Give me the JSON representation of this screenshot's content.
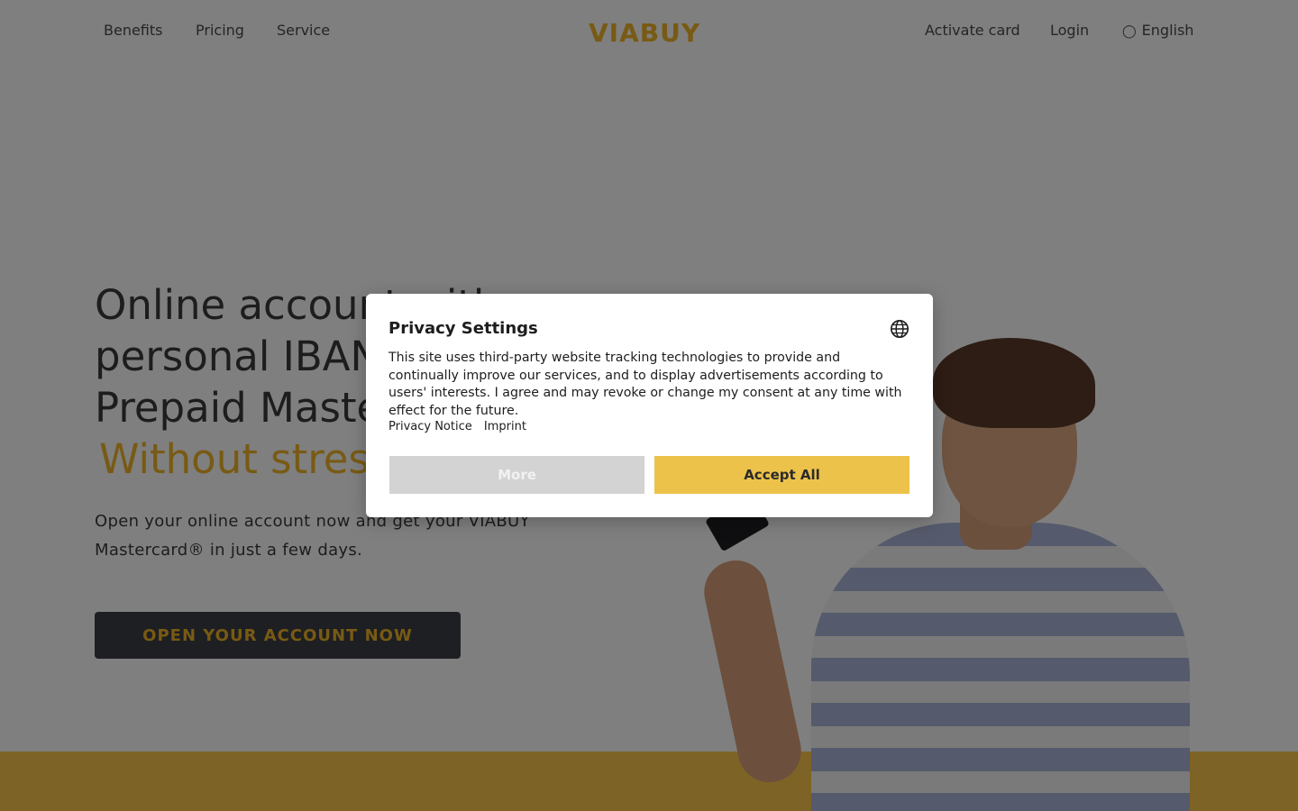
{
  "nav": {
    "left": [
      {
        "label": "Benefits"
      },
      {
        "label": "Pricing"
      },
      {
        "label": "Service"
      }
    ],
    "logo": "VIABUY",
    "right": {
      "activate": "Activate card",
      "login": "Login",
      "language_icon": "globe-icon",
      "language": "English"
    }
  },
  "hero": {
    "title_lines": [
      "Online account with",
      "personal IBAN and",
      "Prepaid Mastercard®"
    ],
    "title_accent": "Without stress.",
    "subtitle": "Open your online account now and get your VIABUY Mastercard® in just a few days.",
    "cta": "OPEN YOUR ACCOUNT NOW"
  },
  "modal": {
    "title": "Privacy Settings",
    "language_icon": "globe-icon",
    "body": "This site uses third-party website tracking technologies to provide and continually improve our services, and to display advertisements according to users' interests. I agree and may revoke or change my consent at any time with effect for the future.",
    "links": [
      "Privacy Notice",
      "Imprint"
    ],
    "more_label": "More",
    "accept_label": "Accept All"
  },
  "colors": {
    "brand_yellow": "#f0b428",
    "band_yellow": "#fac64a",
    "accept_button": "#ecc24a",
    "more_button": "#d3d3d3",
    "cta_background": "#3c3f45"
  }
}
